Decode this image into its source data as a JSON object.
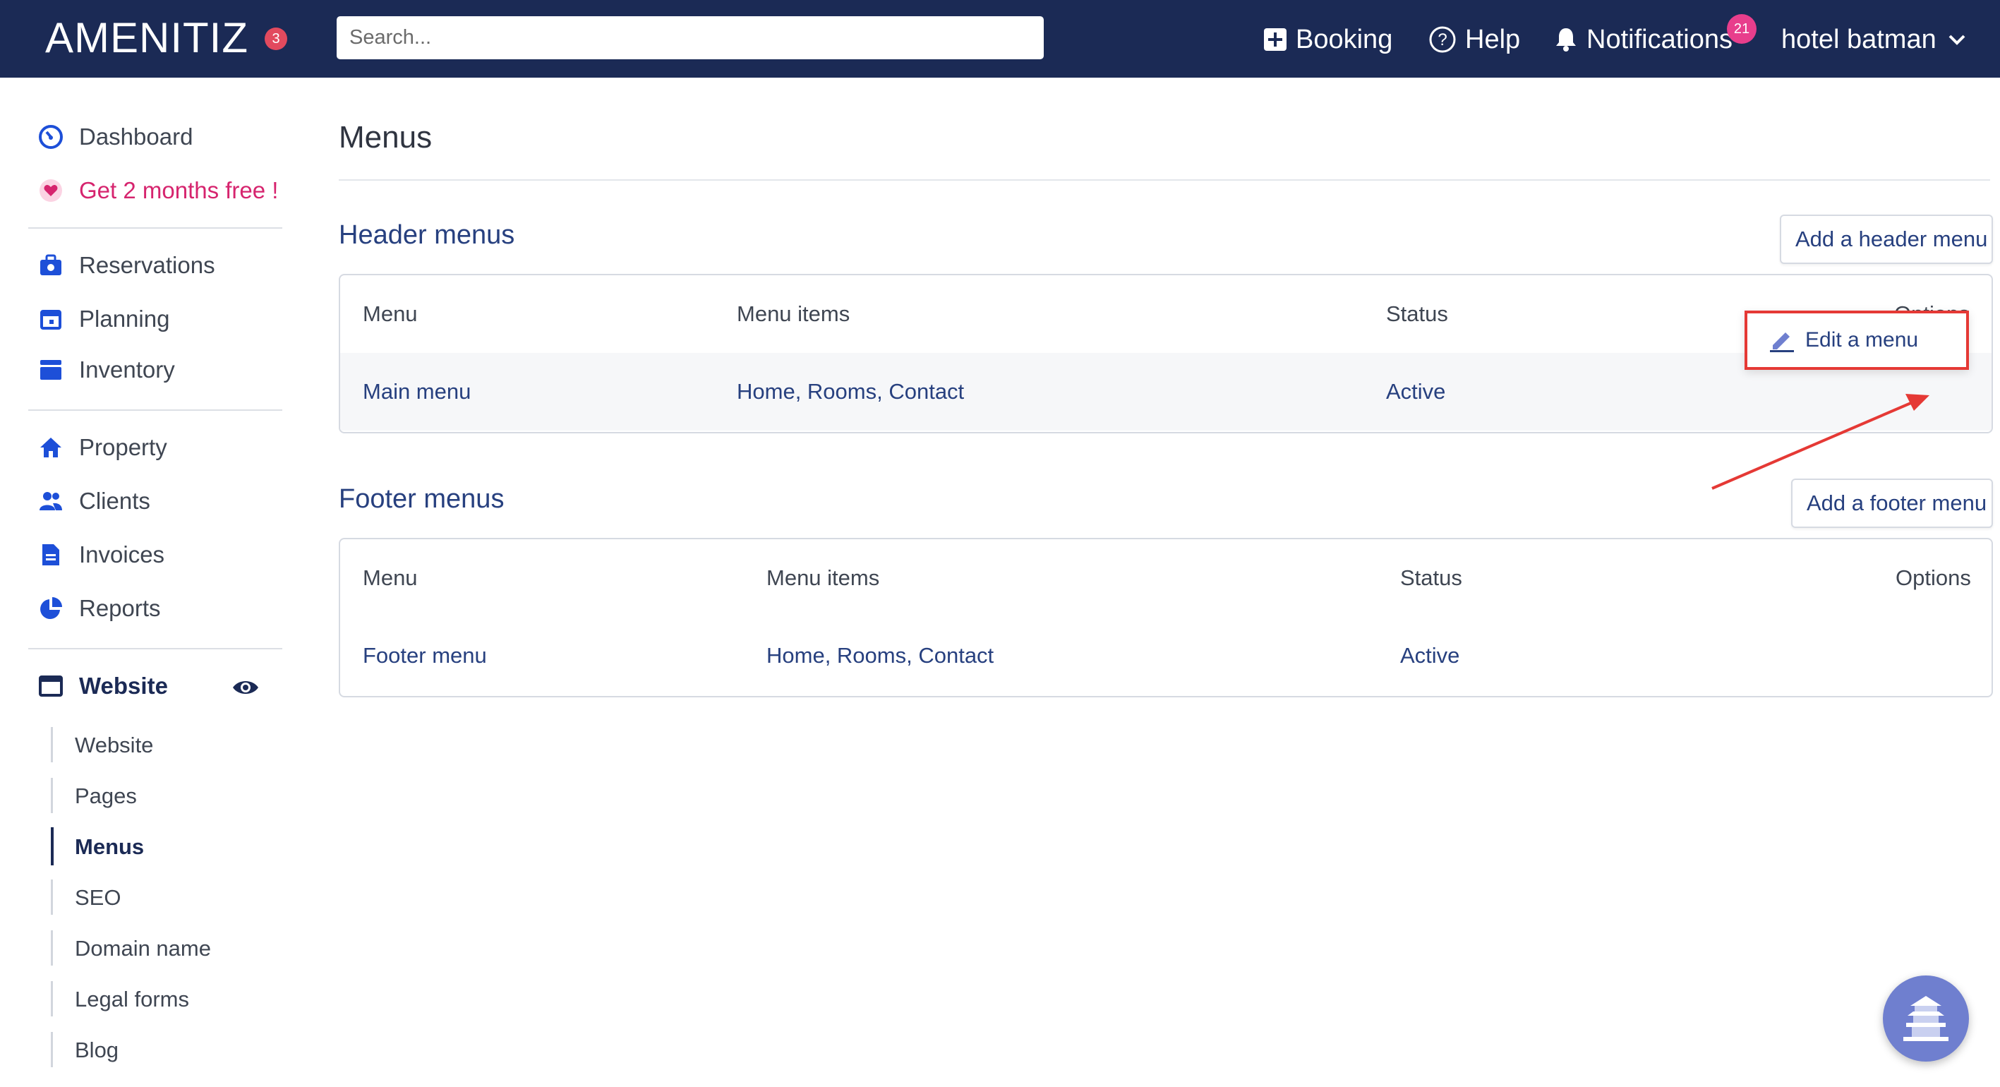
{
  "topbar": {
    "logo": "AMENITIZ",
    "logo_badge": "3",
    "search_placeholder": "Search...",
    "booking_label": "Booking",
    "help_label": "Help",
    "notifications_label": "Notifications",
    "notifications_count": "21",
    "user_label": "hotel batman"
  },
  "sidebar": {
    "dashboard": "Dashboard",
    "promo": "Get 2 months free !",
    "reservations": "Reservations",
    "planning": "Planning",
    "inventory": "Inventory",
    "property": "Property",
    "clients": "Clients",
    "invoices": "Invoices",
    "reports": "Reports",
    "website": "Website",
    "website_sub": [
      "Website",
      "Pages",
      "Menus",
      "SEO",
      "Domain name",
      "Legal forms",
      "Blog"
    ],
    "active_sub": "Menus"
  },
  "main": {
    "page_title": "Menus",
    "header_section": {
      "title": "Header menus",
      "add_button": "Add a header menu",
      "columns": [
        "Menu",
        "Menu items",
        "Status",
        "Options"
      ],
      "rows": [
        {
          "menu": "Main menu",
          "items": "Home, Rooms, Contact",
          "status": "Active"
        }
      ]
    },
    "footer_section": {
      "title": "Footer menus",
      "add_button": "Add a footer menu",
      "columns": [
        "Menu",
        "Menu items",
        "Status",
        "Options"
      ],
      "rows": [
        {
          "menu": "Footer menu",
          "items": "Home, Rooms, Contact",
          "status": "Active"
        }
      ]
    },
    "dropdown": {
      "edit_label": "Edit a menu"
    }
  },
  "colors": {
    "topbar": "#1b2a55",
    "link": "#27407f",
    "promo": "#d6246e",
    "highlight": "#e53935"
  }
}
